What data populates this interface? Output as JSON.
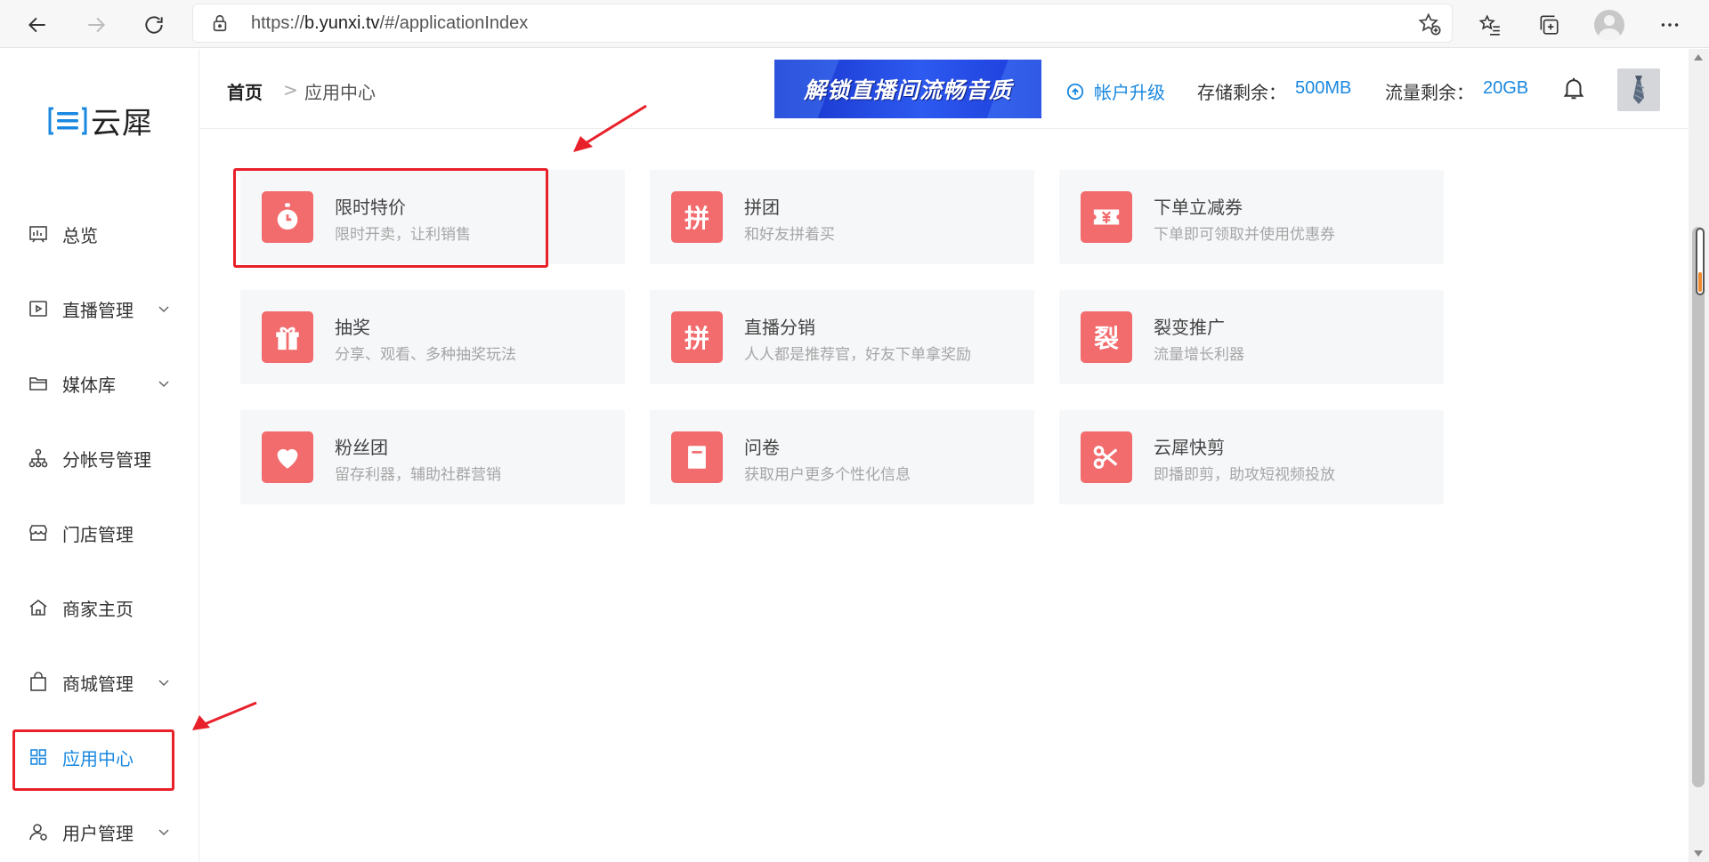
{
  "browser": {
    "url_prefix": "https://",
    "url_host": "b.yunxi.tv",
    "url_path": "/#/applicationIndex"
  },
  "sidebar": {
    "logo_text": "云犀",
    "items": [
      {
        "label": "总览",
        "icon": "chart-icon",
        "expandable": false
      },
      {
        "label": "直播管理",
        "icon": "play-icon",
        "expandable": true
      },
      {
        "label": "媒体库",
        "icon": "folder-icon",
        "expandable": true
      },
      {
        "label": "分帐号管理",
        "icon": "org-icon",
        "expandable": false
      },
      {
        "label": "门店管理",
        "icon": "store-icon",
        "expandable": false
      },
      {
        "label": "商家主页",
        "icon": "home-icon",
        "expandable": false
      },
      {
        "label": "商城管理",
        "icon": "bag-icon",
        "expandable": true
      },
      {
        "label": "应用中心",
        "icon": "grid-icon",
        "expandable": false,
        "active": true
      },
      {
        "label": "用户管理",
        "icon": "user-icon",
        "expandable": true
      }
    ]
  },
  "header": {
    "breadcrumb_home": "首页",
    "breadcrumb_sep": ">",
    "breadcrumb_current": "应用中心",
    "banner_text": "解锁直播间流畅音质",
    "upgrade_label": "帐户升级",
    "storage_label": "存储剩余：",
    "storage_value": "500MB",
    "traffic_label": "流量剩余：",
    "traffic_value": "20GB"
  },
  "apps": [
    {
      "title": "限时特价",
      "desc": "限时开卖，让利销售",
      "icon": "stopwatch-icon"
    },
    {
      "title": "拼团",
      "desc": "和好友拼着买",
      "icon": "pin-icon",
      "glyph": "拼"
    },
    {
      "title": "下单立减券",
      "desc": "下单即可领取并使用优惠券",
      "icon": "coupon-icon"
    },
    {
      "title": "抽奖",
      "desc": "分享、观看、多种抽奖玩法",
      "icon": "gift-icon"
    },
    {
      "title": "直播分销",
      "desc": "人人都是推荐官，好友下单拿奖励",
      "icon": "pin-icon",
      "glyph": "拼"
    },
    {
      "title": "裂变推广",
      "desc": "流量增长利器",
      "icon": "fission-icon",
      "glyph": "裂"
    },
    {
      "title": "粉丝团",
      "desc": "留存利器，辅助社群营销",
      "icon": "heart-icon"
    },
    {
      "title": "问卷",
      "desc": "获取用户更多个性化信息",
      "icon": "survey-icon"
    },
    {
      "title": "云犀快剪",
      "desc": "即播即剪，助攻短视频投放",
      "icon": "scissors-icon"
    }
  ],
  "colors": {
    "accent": "#1a88e0",
    "app_icon_bg": "#f26b6d",
    "annotation_red": "#e8202a"
  }
}
